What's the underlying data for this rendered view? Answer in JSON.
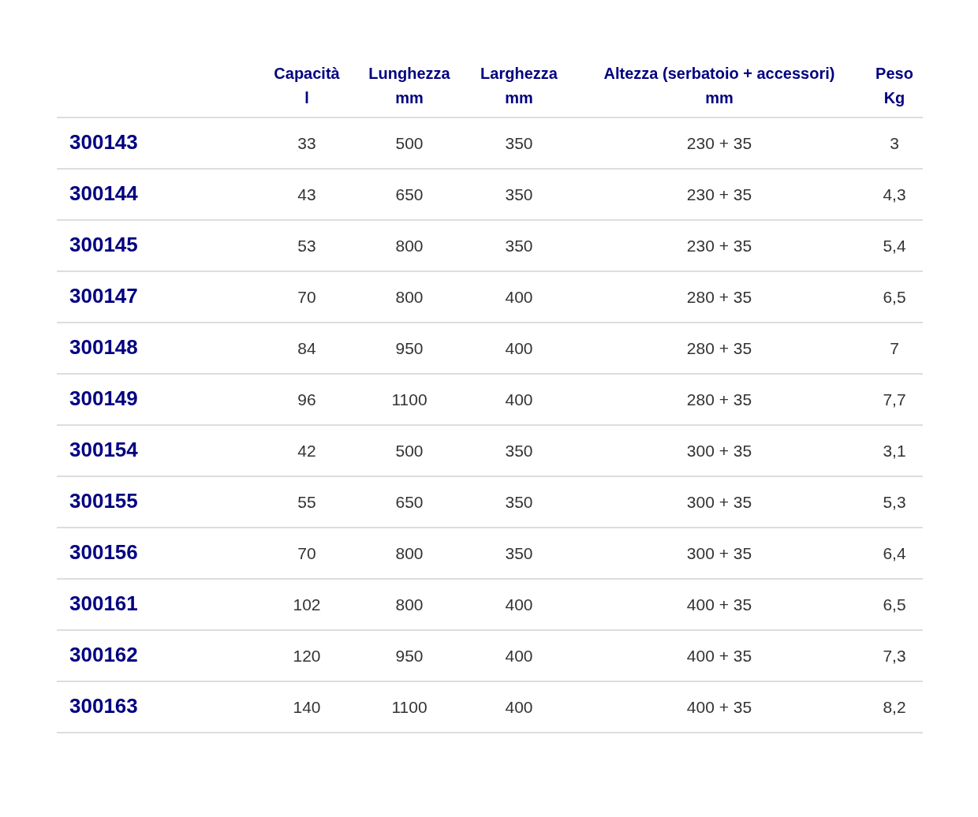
{
  "table": {
    "columns": [
      {
        "label": "Capacità",
        "unit": "l"
      },
      {
        "label": "Lunghezza",
        "unit": "mm"
      },
      {
        "label": "Larghezza",
        "unit": "mm"
      },
      {
        "label": "Altezza (serbatoio + accessori)",
        "unit": "mm"
      },
      {
        "label": "Peso",
        "unit": "Kg"
      }
    ],
    "rows": [
      {
        "code": "300143",
        "cells": [
          "33",
          "500",
          "350",
          "230 + 35",
          "3"
        ]
      },
      {
        "code": "300144",
        "cells": [
          "43",
          "650",
          "350",
          "230 + 35",
          "4,3"
        ]
      },
      {
        "code": "300145",
        "cells": [
          "53",
          "800",
          "350",
          "230 + 35",
          "5,4"
        ]
      },
      {
        "code": "300147",
        "cells": [
          "70",
          "800",
          "400",
          "280 + 35",
          "6,5"
        ]
      },
      {
        "code": "300148",
        "cells": [
          "84",
          "950",
          "400",
          "280 + 35",
          "7"
        ]
      },
      {
        "code": "300149",
        "cells": [
          "96",
          "1100",
          "400",
          "280 + 35",
          "7,7"
        ]
      },
      {
        "code": "300154",
        "cells": [
          "42",
          "500",
          "350",
          "300 + 35",
          "3,1"
        ]
      },
      {
        "code": "300155",
        "cells": [
          "55",
          "650",
          "350",
          "300 + 35",
          "5,3"
        ]
      },
      {
        "code": "300156",
        "cells": [
          "70",
          "800",
          "350",
          "300 + 35",
          "6,4"
        ]
      },
      {
        "code": "300161",
        "cells": [
          "102",
          "800",
          "400",
          "400 + 35",
          "6,5"
        ]
      },
      {
        "code": "300162",
        "cells": [
          "120",
          "950",
          "400",
          "400 + 35",
          "7,3"
        ]
      },
      {
        "code": "300163",
        "cells": [
          "140",
          "1100",
          "400",
          "400 + 35",
          "8,2"
        ]
      }
    ]
  }
}
